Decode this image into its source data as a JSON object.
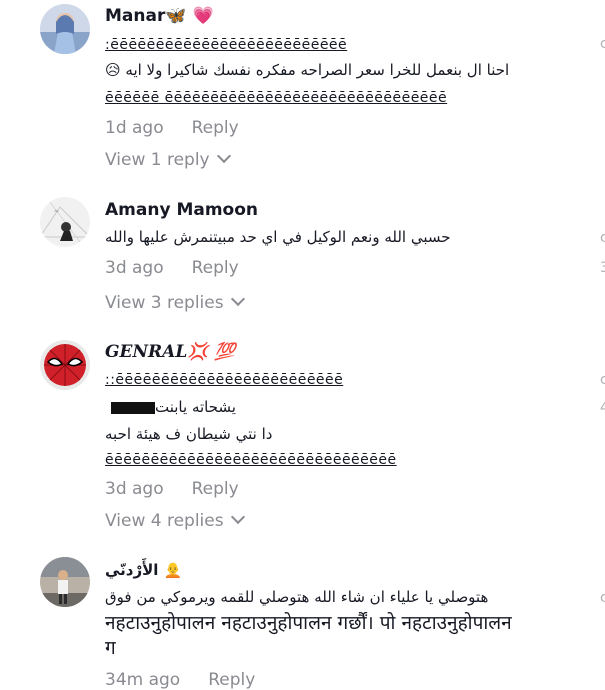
{
  "comments": [
    {
      "author": "Manar",
      "author_emoji": "🦋 💗",
      "lines": [
        ":ēēēēēēēēēēēēēēēēēēēēēēēēēē",
        "احنا ال بنعمل للخرا سعر الصراحه مفكره نفسك شاكيرا ولا ايه 😥",
        "ēēēēēē ēēēēēēēēēēēēēēēēēēēēēēēēēēēēēēē"
      ],
      "time": "1d ago",
      "reply_label": "Reply",
      "view_replies": "View 1 reply"
    },
    {
      "author": "Amany Mamoon",
      "lines": [
        "حسبي الله ونعم الوكيل في اي حد مبيتنمرش عليها والله"
      ],
      "time": "3d ago",
      "reply_label": "Reply",
      "view_replies": "View 3 replies"
    },
    {
      "author": "GENRAL",
      "author_emoji": "💢 💯",
      "lines": [
        "::ēēēēēēēēēēēēēēēēēēēēēēēēē",
        "يشحاته يابنت",
        "دا نتي شيطان ف هيئة احبه",
        "ēēēēēēēēēēēēēēēēēēēēēēēēēēēēēēēē"
      ],
      "time": "3d ago",
      "reply_label": "Reply",
      "view_replies": "View 4 replies"
    },
    {
      "author": "الأَرْدنّي",
      "author_emoji": "🧑‍🦲",
      "lines": [
        "هتوصلي يا علياء ان شاء الله هتوصلي للقمه ويرموكي من فوق",
        "नहटाउनुहोपालन नहटाउनुहोपालन गर्छौं। पो नहटाउनुहोपालन",
        "ग"
      ],
      "time": "34m ago",
      "reply_label": "Reply"
    }
  ],
  "edge_glyphs": [
    "c",
    "3",
    "c",
    "4",
    "c"
  ]
}
